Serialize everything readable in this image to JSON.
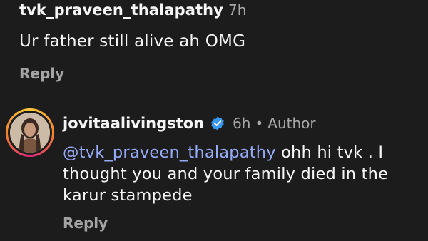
{
  "comment1": {
    "username": "tvk_praveen_thalapathy",
    "time": "7h",
    "text": "Ur father still alive ah OMG",
    "reply_label": "Reply"
  },
  "comment2": {
    "username": "jovitaalivingston",
    "time": "6h",
    "separator": "•",
    "author_label": "Author",
    "mention": "@tvk_praveen_thalapathy",
    "text_line1_rest": " ohh hi tvk . I",
    "text_line2": "thought you and your family died in the",
    "text_line3": "karur stampede",
    "reply_label": "Reply",
    "verified_color": "#3897f0"
  },
  "colors": {
    "background": "#1c1c1d",
    "primary_text": "#f5f5f5",
    "secondary_text": "#a8a8a8",
    "mention": "#95a9f5"
  }
}
